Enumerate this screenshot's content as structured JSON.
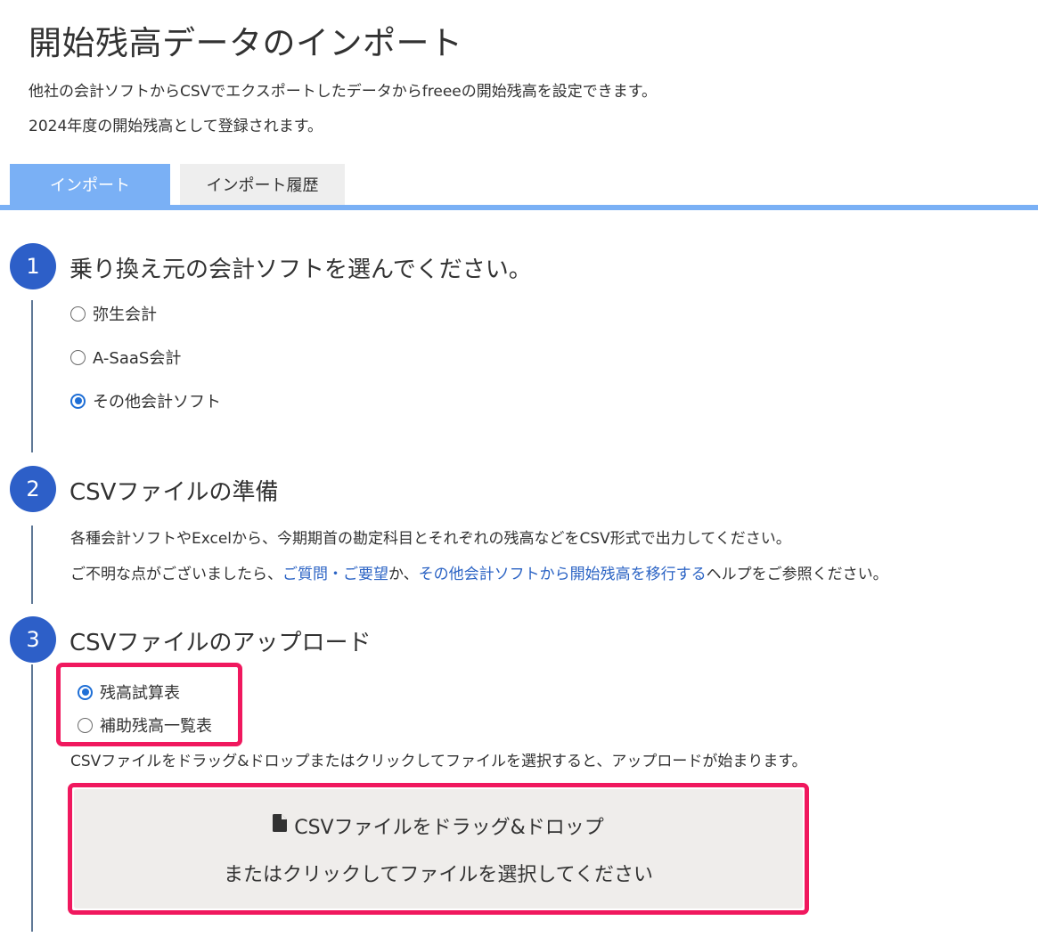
{
  "header": {
    "title": "開始残高データのインポート",
    "description1": "他社の会計ソフトからCSVでエクスポートしたデータからfreeeの開始残高を設定できます。",
    "description2": "2024年度の開始残高として登録されます。"
  },
  "tabs": [
    {
      "label": "インポート",
      "active": true
    },
    {
      "label": "インポート履歴",
      "active": false
    }
  ],
  "step1": {
    "number": "1",
    "title": "乗り換え元の会計ソフトを選んでください。",
    "options": [
      {
        "label": "弥生会計",
        "selected": false
      },
      {
        "label": "A-SaaS会計",
        "selected": false
      },
      {
        "label": "その他会計ソフト",
        "selected": true
      }
    ]
  },
  "step2": {
    "number": "2",
    "title": "CSVファイルの準備",
    "text1": "各種会計ソフトやExcelから、今期期首の勘定科目とそれぞれの残高などをCSV形式で出力してください。",
    "text2_prefix": "ご不明な点がございましたら、",
    "link1": "ご質問・ご要望",
    "text2_mid": "か、",
    "link2": "その他会計ソフトから開始残高を移行する",
    "text2_suffix": "ヘルプをご参照ください。"
  },
  "step3": {
    "number": "3",
    "title": "CSVファイルのアップロード",
    "options": [
      {
        "label": "残高試算表",
        "selected": true
      },
      {
        "label": "補助残高一覧表",
        "selected": false
      }
    ],
    "instruction": "CSVファイルをドラッグ&ドロップまたはクリックしてファイルを選択すると、アップロードが始まります。",
    "dropzone_line1": "CSVファイルをドラッグ&ドロップ",
    "dropzone_line2": "またはクリックしてファイルを選択してください"
  },
  "icons": {
    "file": "file-icon"
  },
  "colors": {
    "accent": "#7ab0f5",
    "step_circle": "#2d5fc8",
    "link": "#2b63c4",
    "highlight": "#f0185e",
    "dropzone_bg": "#efedeb"
  }
}
